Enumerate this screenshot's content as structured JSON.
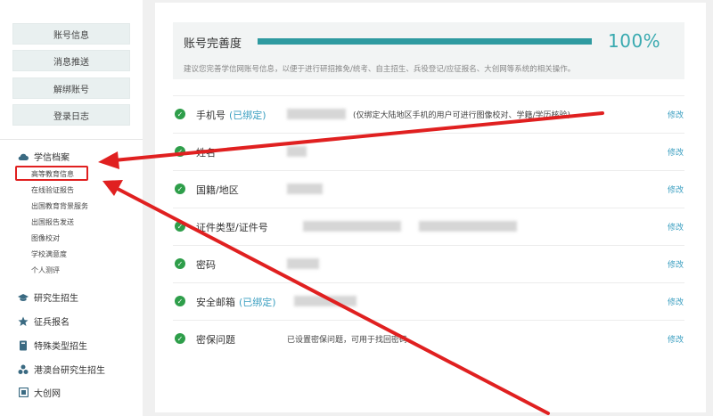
{
  "sidebar": {
    "buttons": [
      "账号信息",
      "消息推送",
      "解绑账号",
      "登录日志"
    ],
    "archive": {
      "title": "学信档案",
      "icon": "cloud-icon",
      "items": [
        "高等教育信息",
        "在线验证报告",
        "出国教育背景服务",
        "出国报告发送",
        "图像校对",
        "学校满意度",
        "个人测评"
      ]
    },
    "nav": [
      {
        "label": "研究生招生",
        "icon": "graduation-cap-icon"
      },
      {
        "label": "征兵报名",
        "icon": "star-icon"
      },
      {
        "label": "特殊类型招生",
        "icon": "book-icon"
      },
      {
        "label": "港澳台研究生招生",
        "icon": "cluster-icon"
      },
      {
        "label": "大创网",
        "icon": "grid-icon"
      }
    ]
  },
  "progress": {
    "title": "账号完善度",
    "percent_text": "100%",
    "percent": 1.0,
    "note": "建议您完善学信网账号信息，以便于进行研招推免/统考、自主招生、兵役登记/应征报名、大创网等系统的相关操作。"
  },
  "rows": [
    {
      "label": "手机号",
      "tag": "(已绑定)",
      "value": "(仅绑定大陆地区手机的用户可进行图像校对、学籍/学历核验)",
      "edit": "修改"
    },
    {
      "label": "姓名",
      "tag": "",
      "value": "",
      "edit": "修改"
    },
    {
      "label": "国籍/地区",
      "tag": "",
      "value": "",
      "edit": "修改"
    },
    {
      "label": "证件类型/证件号",
      "tag": "",
      "value": "",
      "edit": "修改"
    },
    {
      "label": "密码",
      "tag": "",
      "value": "",
      "edit": "修改"
    },
    {
      "label": "安全邮箱",
      "tag": "(已绑定)",
      "value": "",
      "edit": "修改"
    },
    {
      "label": "密保问题",
      "tag": "",
      "value": "已设置密保问题，可用于找回密码。",
      "edit": "修改"
    }
  ],
  "colors": {
    "accent": "#2f9aa0",
    "link": "#3a9ec0",
    "check": "#2e9e4a",
    "annotation": "#e02020"
  }
}
